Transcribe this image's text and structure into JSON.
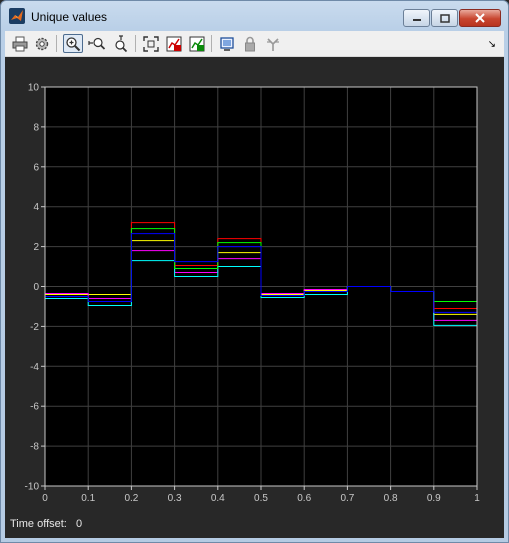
{
  "window": {
    "title": "Unique values"
  },
  "toolbar": {
    "buttons": [
      {
        "name": "print-icon"
      },
      {
        "name": "settings-gear-icon"
      },
      {
        "name": "zoom-in-icon",
        "active": true
      },
      {
        "name": "zoom-x-icon"
      },
      {
        "name": "zoom-y-icon"
      },
      {
        "name": "autoscale-icon"
      },
      {
        "name": "save-axes-limits-icon"
      },
      {
        "name": "restore-axes-limits-icon"
      },
      {
        "name": "highlight-simulink-block-icon"
      },
      {
        "name": "lock-icon"
      },
      {
        "name": "signal-selector-icon"
      }
    ],
    "dock_glyph": "↘"
  },
  "chart_data": {
    "type": "line",
    "style": "stairs",
    "xlim": [
      0,
      1
    ],
    "ylim": [
      -10,
      10
    ],
    "x_ticks": [
      "0",
      "0.1",
      "0.2",
      "0.3",
      "0.4",
      "0.5",
      "0.6",
      "0.7",
      "0.8",
      "0.9",
      "1"
    ],
    "y_ticks": [
      "-10",
      "-8",
      "-6",
      "-4",
      "-2",
      "0",
      "2",
      "4",
      "6",
      "8",
      "10"
    ],
    "grid": true,
    "background": "#000000",
    "axes_color": "#c8c8c8",
    "x": [
      0,
      0.1,
      0.2,
      0.3,
      0.4,
      0.5,
      0.6,
      0.7,
      0.8,
      0.9,
      1.0
    ],
    "series": [
      {
        "color": "#ffff00",
        "values": [
          -0.4,
          -0.4,
          2.3,
          0.9,
          1.7,
          -0.4,
          -0.2,
          0.0,
          -0.25,
          -1.4
        ]
      },
      {
        "color": "#ff00ff",
        "values": [
          -0.35,
          -0.6,
          1.8,
          0.7,
          1.4,
          -0.35,
          -0.15,
          0.0,
          -0.25,
          -1.7
        ]
      },
      {
        "color": "#00ffff",
        "values": [
          -0.6,
          -0.95,
          1.3,
          0.5,
          1.0,
          -0.55,
          -0.4,
          0.0,
          -0.25,
          -1.95
        ]
      },
      {
        "color": "#ff0000",
        "values": [
          -0.5,
          -0.75,
          3.2,
          1.05,
          2.4,
          -0.45,
          -0.25,
          0.0,
          -0.25,
          -1.1
        ]
      },
      {
        "color": "#00ff00",
        "values": [
          -0.5,
          -0.75,
          2.9,
          0.9,
          2.2,
          -0.45,
          -0.25,
          0.0,
          -0.25,
          -0.75
        ]
      },
      {
        "color": "#0000ff",
        "values": [
          -0.5,
          -0.75,
          2.65,
          1.25,
          2.0,
          -0.45,
          -0.25,
          0.0,
          -0.25,
          -1.3
        ]
      }
    ]
  },
  "status": {
    "time_offset_label": "Time offset:",
    "time_offset_value": "0"
  }
}
